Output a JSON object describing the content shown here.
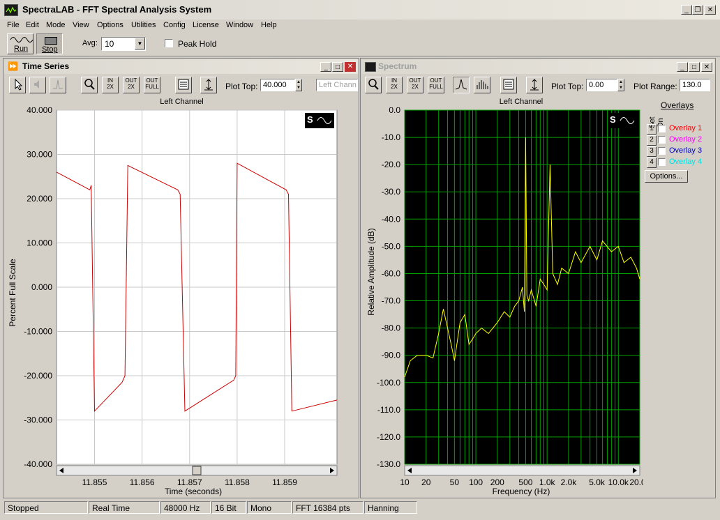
{
  "app": {
    "title": "SpectraLAB - FFT Spectral Analysis System"
  },
  "menu": [
    "File",
    "Edit",
    "Mode",
    "View",
    "Options",
    "Utilities",
    "Config",
    "License",
    "Window",
    "Help"
  ],
  "toolbar": {
    "run_label": "Run",
    "stop_label": "Stop",
    "avg_label": "Avg:",
    "avg_value": "10",
    "peak_hold_label": "Peak Hold"
  },
  "time_series": {
    "title": "Time Series",
    "plot_top_label": "Plot Top:",
    "plot_top_value": "40.000",
    "channel_placeholder": "Left Chann",
    "plot_title": "Left Channel",
    "ylabel": "Percent Full Scale",
    "xlabel": "Time (seconds)"
  },
  "spectrum": {
    "title": "Spectrum",
    "plot_top_label": "Plot Top:",
    "plot_top_value": "0.00",
    "plot_range_label": "Plot Range:",
    "plot_range_value": "130.0",
    "plot_title": "Left Channel",
    "ylabel": "Relative Amplitude (dB)",
    "xlabel": "Frequency (Hz)",
    "overlays_label": "Overlays",
    "set_label": "Set",
    "on_label": "On",
    "overlays": [
      {
        "num": "1",
        "name": "Overlay 1",
        "color": "#ff0000"
      },
      {
        "num": "2",
        "name": "Overlay 2",
        "color": "#ff00ff"
      },
      {
        "num": "3",
        "name": "Overlay 3",
        "color": "#0000c0"
      },
      {
        "num": "4",
        "name": "Overlay 4",
        "color": "#00e0e0"
      }
    ],
    "options_label": "Options..."
  },
  "chart_data": [
    {
      "type": "line",
      "title": "Left Channel",
      "xlabel": "Time (seconds)",
      "ylabel": "Percent Full Scale",
      "xlim": [
        11.8542,
        11.8601
      ],
      "ylim": [
        -40,
        40
      ],
      "xticks": [
        "11.855",
        "11.856",
        "11.857",
        "11.858",
        "11.859"
      ],
      "yticks": [
        "40.000",
        "30.000",
        "20.000",
        "10.000",
        "0.000",
        "-10.000",
        "-20.000",
        "-30.000",
        "-40.000"
      ],
      "series": [
        {
          "color": "#cc0000",
          "x": [
            11.8542,
            11.8549,
            11.85493,
            11.855,
            11.85558,
            11.85564,
            11.8557,
            11.85675,
            11.8568,
            11.8569,
            11.85793,
            11.85797,
            11.858,
            11.85903,
            11.85908,
            11.85915,
            11.8601
          ],
          "y": [
            26,
            22,
            23,
            -28,
            -21.5,
            -20,
            27.5,
            22,
            21,
            -28,
            -21,
            -20,
            28,
            22,
            21,
            -28,
            -25.5
          ]
        }
      ]
    },
    {
      "type": "line",
      "title": "Left Channel",
      "xlabel": "Frequency (Hz)",
      "ylabel": "Relative Amplitude (dB)",
      "x_scale": "log",
      "xlim": [
        10,
        20000
      ],
      "ylim": [
        -130,
        0
      ],
      "xticks": [
        "10",
        "20",
        "50",
        "100",
        "200",
        "500",
        "1.0k",
        "2.0k",
        "5.0k",
        "10.0k",
        "20.0k"
      ],
      "yticks": [
        "0.0",
        "-10.0",
        "-20.0",
        "-30.0",
        "-40.0",
        "-50.0",
        "-60.0",
        "-70.0",
        "-80.0",
        "-90.0",
        "-100.0",
        "-110.0",
        "-120.0",
        "-130.0"
      ],
      "background": "#000000",
      "grid_color": "#00a000",
      "series": [
        {
          "color": "#ffff00",
          "x": [
            10,
            12,
            15,
            20,
            25,
            30,
            35,
            40,
            45,
            50,
            60,
            70,
            80,
            90,
            100,
            120,
            150,
            200,
            250,
            300,
            350,
            400,
            450,
            480,
            500,
            520,
            550,
            600,
            700,
            800,
            900,
            1000,
            1100,
            1200,
            1400,
            1600,
            2000,
            2500,
            3000,
            4000,
            5000,
            6000,
            8000,
            10000,
            12000,
            15000,
            18000,
            20000
          ],
          "y": [
            -98,
            -92,
            -90,
            -90,
            -91,
            -82,
            -73,
            -80,
            -86,
            -92,
            -78,
            -75,
            -86,
            -84,
            -82,
            -80,
            -82,
            -78,
            -74,
            -76,
            -72,
            -70,
            -65,
            -74,
            -10,
            -68,
            -70,
            -66,
            -72,
            -62,
            -64,
            -66,
            -20,
            -60,
            -64,
            -58,
            -60,
            -52,
            -56,
            -50,
            -55,
            -48,
            -52,
            -50,
            -56,
            -54,
            -58,
            -62
          ]
        }
      ]
    }
  ],
  "status": {
    "state": "Stopped",
    "mode": "Real Time",
    "rate": "48000 Hz",
    "bits": "16 Bit",
    "channels": "Mono",
    "fft": "FFT 16384 pts",
    "window": "Hanning"
  }
}
